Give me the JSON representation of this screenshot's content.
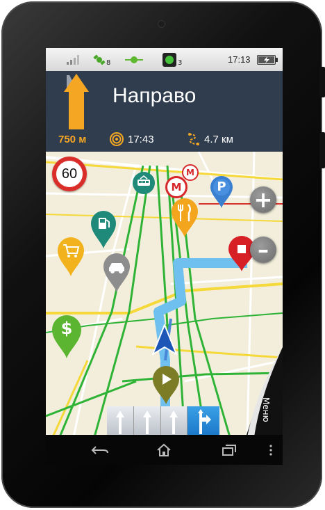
{
  "status_bar": {
    "gps_count": "8",
    "traffic_count": "3",
    "time": "17:13"
  },
  "nav_header": {
    "direction": "Направо",
    "distance_to_turn": "750 м",
    "arrival_time": "17:43",
    "remaining_distance": "4.7 км"
  },
  "map": {
    "speed_limit": "60",
    "metro_symbol": "М",
    "parking_symbol": "P",
    "dollar_symbol": "$",
    "zoom_in_label": "+",
    "zoom_out_label": "–",
    "menu_label": "Меню"
  },
  "colors": {
    "accent_orange": "#f5a623",
    "header_bg": "#2f3d4f",
    "route_blue": "#6fc0ee",
    "road_green": "#2fb336",
    "road_yellow": "#f5d83a"
  }
}
